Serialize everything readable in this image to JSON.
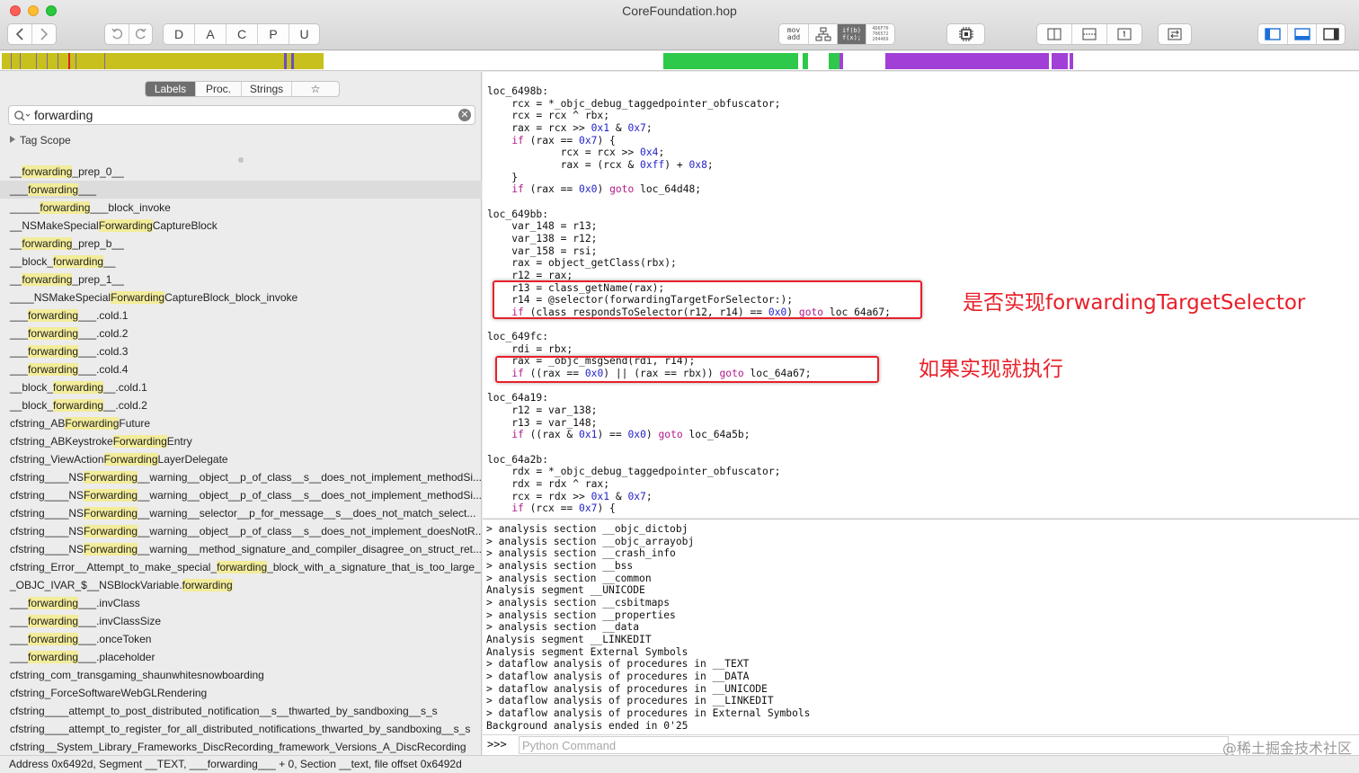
{
  "window": {
    "title": "CoreFoundation.hop"
  },
  "toolbar": {
    "mode_buttons": [
      "D",
      "A",
      "C",
      "P",
      "U"
    ],
    "asm_mode_label": "mov\nadd",
    "pseudo_mode_label": "if(b)\nf(x);",
    "hex_mode_label": "4D6F70\n706572\n204469"
  },
  "nav_colors": {
    "code": "#c8c01c",
    "procedure": "#2ec94a",
    "objc": "#a23fd6",
    "marker": "#e02020",
    "unexplored": "#ffffff"
  },
  "left_panel": {
    "tabs": [
      {
        "label": "Labels",
        "active": true
      },
      {
        "label": "Proc.",
        "active": false
      },
      {
        "label": "Strings",
        "active": false
      },
      {
        "label": "☆",
        "active": false
      }
    ],
    "search": {
      "value": "forwarding",
      "placeholder": ""
    },
    "tag_scope": "Tag Scope",
    "labels": [
      "__forwarding_prep_0__",
      "___forwarding___",
      "_____forwarding___block_invoke",
      "__NSMakeSpecialForwardingCaptureBlock",
      "__forwarding_prep_b__",
      "__block_forwarding__",
      "__forwarding_prep_1__",
      "____NSMakeSpecialForwardingCaptureBlock_block_invoke",
      "___forwarding___.cold.1",
      "___forwarding___.cold.2",
      "___forwarding___.cold.3",
      "___forwarding___.cold.4",
      "__block_forwarding__.cold.1",
      "__block_forwarding__.cold.2",
      "cfstring_ABForwardingFuture",
      "cfstring_ABKeystrokeForwardingEntry",
      "cfstring_ViewActionForwardingLayerDelegate",
      "cfstring____NSForwarding__warning__object__p_of_class__s__does_not_implement_methodSi...",
      "cfstring____NSForwarding__warning__object__p_of_class__s__does_not_implement_methodSi...",
      "cfstring____NSForwarding__warning__selector__p_for_message__s__does_not_match_select...",
      "cfstring____NSForwarding__warning__object__p_of_class__s__does_not_implement_doesNotR...",
      "cfstring____NSForwarding__warning__method_signature_and_compiler_disagree_on_struct_ret...",
      "cfstring_Error__Attempt_to_make_special_forwarding_block_with_a_signature_that_is_too_large_",
      "_OBJC_IVAR_$__NSBlockVariable.forwarding",
      "___forwarding___.invClass",
      "___forwarding___.invClassSize",
      "___forwarding___.onceToken",
      "___forwarding___.placeholder",
      "cfstring_com_transgaming_shaunwhitesnowboarding",
      "cfstring_ForceSoftwareWebGLRendering",
      "cfstring____attempt_to_post_distributed_notification__s__thwarted_by_sandboxing__s_s",
      "cfstring____attempt_to_register_for_all_distributed_notifications_thwarted_by_sandboxing__s_s",
      "cfstring__System_Library_Frameworks_DiscRecording_framework_Versions_A_DiscRecording"
    ],
    "selected_index": 1
  },
  "code": {
    "lines": [
      "loc_6498b:",
      "    rcx = *_objc_debug_taggedpointer_obfuscator;",
      "    rcx = rcx ^ rbx;",
      "    rax = rcx >> 0x1 & 0x7;",
      "    if (rax == 0x7) {",
      "            rcx = rcx >> 0x4;",
      "            rax = (rcx & 0xff) + 0x8;",
      "    }",
      "    if (rax == 0x0) goto loc_64d48;",
      "",
      "loc_649bb:",
      "    var_148 = r13;",
      "    var_138 = r12;",
      "    var_158 = rsi;",
      "    rax = object_getClass(rbx);",
      "    r12 = rax;",
      "    r13 = class_getName(rax);",
      "    r14 = @selector(forwardingTargetForSelector:);",
      "    if (class_respondsToSelector(r12, r14) == 0x0) goto loc_64a67;",
      "",
      "loc_649fc:",
      "    rdi = rbx;",
      "    rax = _objc_msgSend(rdi, r14);",
      "    if ((rax == 0x0) || (rax == rbx)) goto loc_64a67;",
      "",
      "loc_64a19:",
      "    r12 = var_138;",
      "    r13 = var_148;",
      "    if ((rax & 0x1) == 0x0) goto loc_64a5b;",
      "",
      "loc_64a2b:",
      "    rdx = *_objc_debug_taggedpointer_obfuscator;",
      "    rdx = rdx ^ rax;",
      "    rcx = rdx >> 0x1 & 0x7;",
      "    if (rcx == 0x7) {"
    ],
    "annotations": {
      "note1": "是否实现forwardingTargetSelector",
      "note2": "如果实现就执行"
    }
  },
  "console": {
    "lines": [
      "> analysis section __objc_dictobj",
      "> analysis section __objc_arrayobj",
      "> analysis section __crash_info",
      "> analysis section __bss",
      "> analysis section __common",
      "Analysis segment __UNICODE",
      "> analysis section __csbitmaps",
      "> analysis section __properties",
      "> analysis section __data",
      "Analysis segment __LINKEDIT",
      "Analysis segment External Symbols",
      "> dataflow analysis of procedures in __TEXT",
      "> dataflow analysis of procedures in __DATA",
      "> dataflow analysis of procedures in __UNICODE",
      "> dataflow analysis of procedures in __LINKEDIT",
      "> dataflow analysis of procedures in External Symbols",
      "Background analysis ended in 0'25"
    ],
    "prompt": ">>>",
    "input_placeholder": "Python Command",
    "watermark": "@稀土掘金技术社区"
  },
  "status_bar": "Address 0x6492d, Segment __TEXT, ___forwarding___ + 0, Section __text, file offset 0x6492d"
}
